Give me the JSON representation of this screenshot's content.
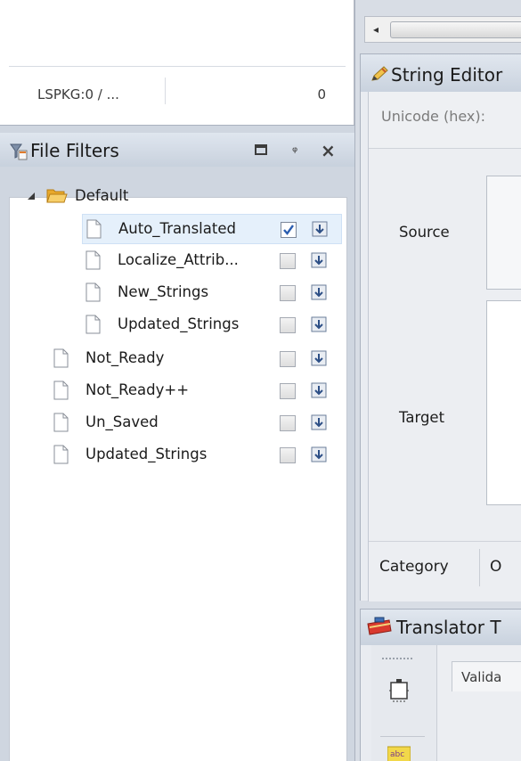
{
  "status_bar": {
    "left_text": "LSPKG:0 / ...",
    "right_text": "0"
  },
  "file_filters": {
    "title": "File Filters",
    "icons": {
      "panel": "funnel-icon",
      "restore": "window-restore-icon",
      "pin": "pin-icon",
      "close": "close-icon"
    },
    "tree": {
      "root_label": "Default",
      "children": [
        {
          "label": "Auto_Translated",
          "checked": true
        },
        {
          "label": "Localize_Attrib...",
          "checked": false
        },
        {
          "label": "New_Strings",
          "checked": false
        },
        {
          "label": "Updated_Strings",
          "checked": false
        }
      ],
      "top_level": [
        {
          "label": "Not_Ready",
          "checked": false
        },
        {
          "label": "Not_Ready++",
          "checked": false
        },
        {
          "label": "Un_Saved",
          "checked": false
        },
        {
          "label": "Updated_Strings",
          "checked": false
        }
      ]
    }
  },
  "string_editor": {
    "title": "String Editor",
    "unicode_label": "Unicode (hex):",
    "source_label": "Source",
    "target_label": "Target",
    "category_label": "Category",
    "next_label_fragment": "O"
  },
  "translator_toolbox": {
    "title": "Translator T",
    "validate_tab": "Valida",
    "tool2_text": "abc"
  },
  "colors": {
    "panel_header": "#c9d2de",
    "selection": "#e5f0fb",
    "folder": "#f2b941",
    "checkmark": "#2a5db0"
  }
}
